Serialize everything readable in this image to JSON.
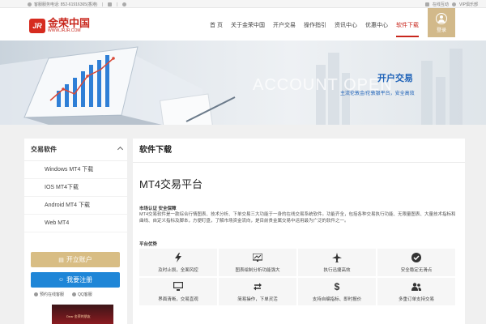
{
  "topbar": {
    "hotline": "客服服务电话: 852-61916365(香港)",
    "online_service": "在线互动",
    "vip": "VIP俱乐部"
  },
  "header": {
    "logo_mark": "JR",
    "logo_cn": "金荣中国",
    "logo_en": "WWW.JRJR.COM",
    "nav": [
      "首 页",
      "关于金荣中国",
      "开户交易",
      "操作指引",
      "资讯中心",
      "优惠中心",
      "软件下载"
    ],
    "active_nav": "软件下载",
    "login_label": "登录"
  },
  "banner": {
    "watermark": "ACCOUNT OPEN",
    "title": "开户交易",
    "subtitle": "主流伦敦金/伦敦银平台，安全高效"
  },
  "sidebar": {
    "title": "交易软件",
    "items": [
      "Windows MT4 下载",
      "IOS MT4下载",
      "Android MT4 下载",
      "Web MT4"
    ],
    "open_account": "开立账户",
    "register": "我要注册",
    "link_online": "预约在线客服",
    "link_qq": "QQ客服",
    "ad_text": "Dear 金荣的朋友"
  },
  "content": {
    "header": "软件下载",
    "title": "MT4交易平台",
    "section_label": "市场认证 安全保障",
    "description": "MT4交易软件是一款综合行情图表、技术分析、下单交易三大功能于一身的在线交易系统软件。功能齐全，包括各种交易执行功能、无限量图表、大量技术指标和曲线、自定义指标及脚本，方便盯盘，了解市场资金流向，是目前贵金属交易中运用最为广泛的软件之一。",
    "advantages_label": "平台优势",
    "features": [
      {
        "icon": "lightning-icon",
        "label": "及时止损，全面风控"
      },
      {
        "icon": "chart-icon",
        "label": "图表绘制分析功能强大"
      },
      {
        "icon": "plane-icon",
        "label": "执行迅捷高效"
      },
      {
        "icon": "check-circle-icon",
        "label": "安全稳定无滑点"
      },
      {
        "icon": "desktop-icon",
        "label": "界面清晰，交易直观"
      },
      {
        "icon": "refresh-icon",
        "label": "简易操作，下单灵活"
      },
      {
        "icon": "dollar-icon",
        "label": "支持自编指标、即时报价"
      },
      {
        "icon": "users-icon",
        "label": "多重订单支持交易"
      }
    ]
  }
}
